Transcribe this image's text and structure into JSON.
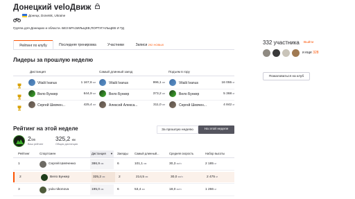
{
  "club": {
    "name": "Донецкий veloДвиж",
    "location": "Донецк, Donetsk, Ukraine",
    "description": "Группа для Донецких и области. БЕЗ БРАЗИЛЬЦЕВ,ПОРТУГАЛЬЦЕВ И ТД"
  },
  "tabs": [
    {
      "label": "Рейтинг по клубу",
      "active": true
    },
    {
      "label": "Последняя тренировка",
      "active": false
    },
    {
      "label": "Участники",
      "active": false
    },
    {
      "label": "Записи",
      "badge": "292 НОВЫХ",
      "active": false
    }
  ],
  "leaders": {
    "title": "Лидеры за прошлую неделю",
    "columns": [
      "Дистанция",
      "Самый длинный заезд",
      "Подъем в гору"
    ],
    "rows": [
      {
        "distance": {
          "name": "Vitalii Ivanus",
          "value": "1 167,6",
          "unit": "км"
        },
        "longest": {
          "name": "Vitalii Ivanus",
          "value": "996,1",
          "unit": "км"
        },
        "climb": {
          "name": "Vitalii Ivanus",
          "value": "16 055",
          "unit": "м"
        }
      },
      {
        "distance": {
          "name": "Вело Бункер",
          "value": "644,9",
          "unit": "км"
        },
        "longest": {
          "name": "Вело Бункер",
          "value": "373,2",
          "unit": "км"
        },
        "climb": {
          "name": "Вело Бункер",
          "value": "5 368",
          "unit": "м"
        }
      },
      {
        "distance": {
          "name": "Сергей Шевчен...",
          "value": "425,4",
          "unit": "км"
        },
        "longest": {
          "name": "Алексей Алекса...",
          "value": "311,0",
          "unit": "км"
        },
        "climb": {
          "name": "Сергей Шевчен...",
          "value": "4 842",
          "unit": "м"
        }
      }
    ]
  },
  "weekly": {
    "title": "Рейтинг на этой неделе",
    "btn_last_week": "За прошлую неделю",
    "btn_this_week": "На этой неделе",
    "my_rank": "2",
    "my_rank_total": "/36",
    "my_rank_label": "Ваш рейтинг",
    "my_distance": "325,2",
    "my_distance_unit": "км",
    "my_distance_label": "Общая дистанция",
    "headers": [
      "Рейтинг",
      "Спортсмен",
      "Дистанция",
      "Заезды",
      "Самый длинный...",
      "Средняя скорость",
      "Набор высоты"
    ],
    "rows": [
      {
        "rank": "1",
        "name": "Сергей Шевченко",
        "distance": "386,9",
        "rides": "6",
        "longest": "101,1",
        "speed": "30,3",
        "elev": "2 185",
        "highlight": false
      },
      {
        "rank": "2",
        "name": "Вело Бункер",
        "distance": "325,2",
        "rides": "2",
        "longest": "214,5",
        "speed": "30,0",
        "elev": "2 475",
        "highlight": true
      },
      {
        "rank": "3",
        "name": "yula nikonova",
        "distance": "195,0",
        "rides": "6",
        "longest": "53,4",
        "speed": "18,0",
        "elev": "1 266",
        "highlight": false
      }
    ],
    "unit_km": "км",
    "unit_speed": "км/ч",
    "unit_m": "м"
  },
  "sidebar": {
    "members_count": "332 участника",
    "leave_link": "Выйти",
    "more_text": "и еще",
    "more_count": "328",
    "invite_button": "Пожаловаться на клуб"
  },
  "colors": {
    "accent": "#fc5200",
    "gold": "#d8a106",
    "badge_bg": "#fc5200"
  }
}
